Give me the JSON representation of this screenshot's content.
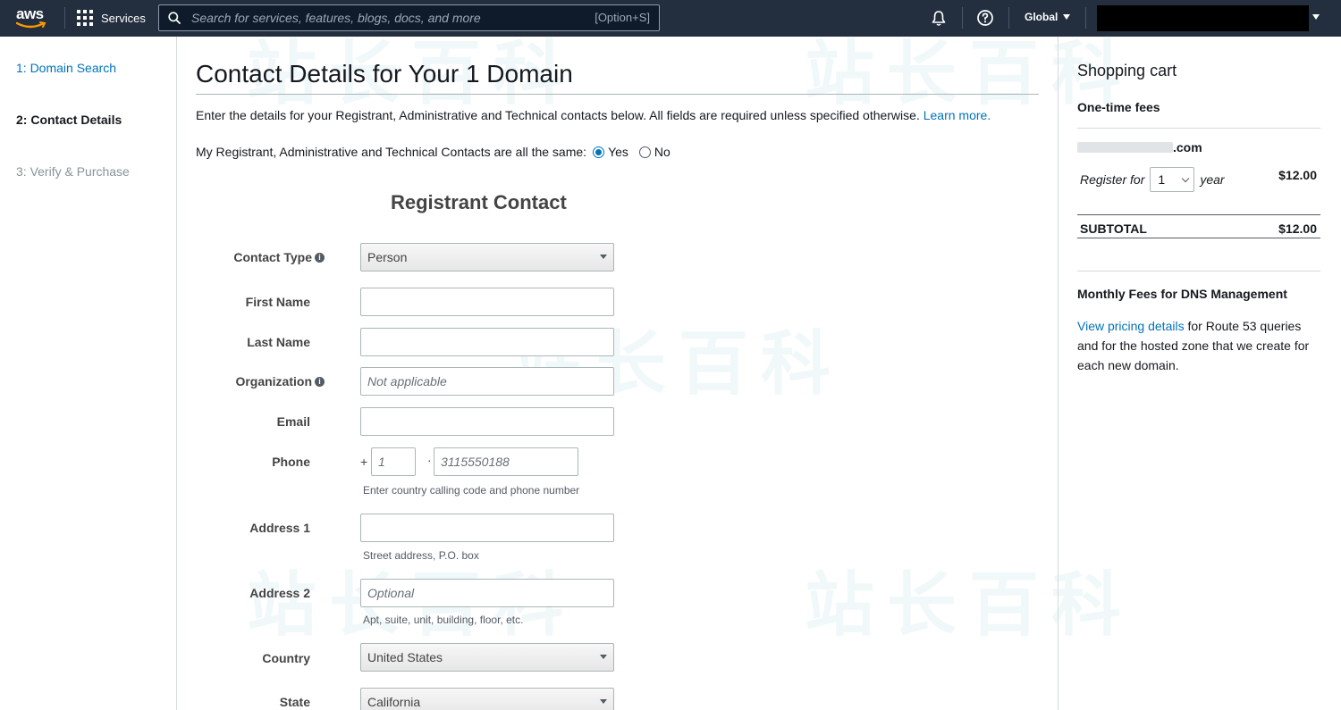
{
  "topnav": {
    "logo_text": "aws",
    "services_label": "Services",
    "search_placeholder": "Search for services, features, blogs, docs, and more",
    "search_shortcut": "[Option+S]",
    "region_label": "Global"
  },
  "steps": [
    {
      "label": "1: Domain Search",
      "state": "link"
    },
    {
      "label": "2: Contact Details",
      "state": "active"
    },
    {
      "label": "3: Verify & Purchase",
      "state": "disabled"
    }
  ],
  "main": {
    "title": "Contact Details for Your 1 Domain",
    "intro_text": "Enter the details for your Registrant, Administrative and Technical contacts below. All fields are required unless specified otherwise.",
    "learn_more": "Learn more.",
    "same_contacts_text": "My Registrant, Administrative and Technical Contacts are all the same:",
    "yes_label": "Yes",
    "no_label": "No",
    "same_selected": "Yes",
    "section_title": "Registrant Contact",
    "form": {
      "contact_type_label": "Contact Type",
      "contact_type_value": "Person",
      "first_name_label": "First Name",
      "first_name_value": "",
      "last_name_label": "Last Name",
      "last_name_value": "",
      "organization_label": "Organization",
      "organization_placeholder": "Not applicable",
      "email_label": "Email",
      "email_value": "",
      "phone_label": "Phone",
      "phone_plus": "+",
      "phone_code_placeholder": "1",
      "phone_dot": "·",
      "phone_number_placeholder": "3115550188",
      "phone_hint": "Enter country calling code and phone number",
      "address1_label": "Address 1",
      "address1_hint": "Street address, P.O. box",
      "address2_label": "Address 2",
      "address2_placeholder": "Optional",
      "address2_hint": "Apt, suite, unit, building, floor, etc.",
      "country_label": "Country",
      "country_value": "United States",
      "state_label": "State",
      "state_value": "California"
    }
  },
  "cart": {
    "title": "Shopping cart",
    "one_time_fees": "One-time fees",
    "domain_suffix": ".com",
    "register_for": "Register for",
    "years_value": "1",
    "year_unit": "year",
    "item_price": "$12.00",
    "subtotal_label": "SUBTOTAL",
    "subtotal_value": "$12.00",
    "monthly_title": "Monthly Fees for DNS Management",
    "pricing_link": "View pricing details",
    "pricing_text": " for Route 53 queries and for the hosted zone that we create for each new domain."
  },
  "watermark_text": "站长百科"
}
